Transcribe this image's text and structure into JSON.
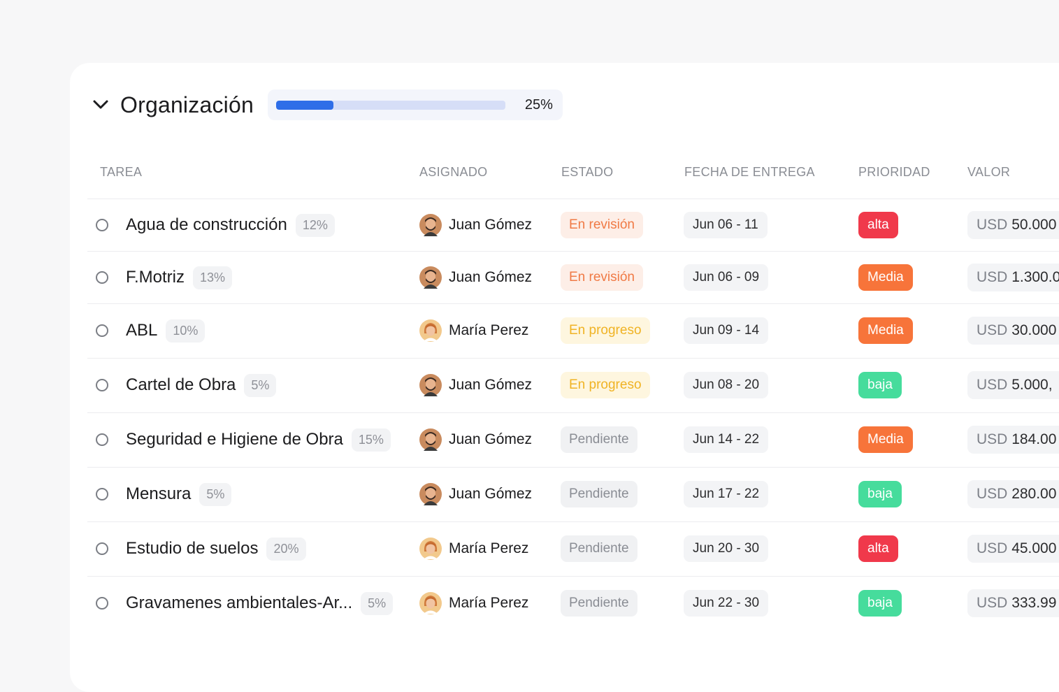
{
  "group": {
    "title": "Organización",
    "progress": 0.25,
    "progress_label": "25%"
  },
  "columns": [
    "TAREA",
    "ASIGNADO",
    "ESTADO",
    "FECHA DE ENTREGA",
    "PRIORIDAD",
    "VALOR"
  ],
  "colors": {
    "en_revision_bg": "#fdeee7",
    "en_revision_fg": "#f07a45",
    "en_progreso_bg": "#fef6df",
    "en_progreso_fg": "#f0b324",
    "pendiente_bg": "#f0f1f3",
    "pendiente_fg": "#8a8d94",
    "alta": "#f0394b",
    "media": "#f7743a",
    "baja": "#46dc9c",
    "progress_fill": "#2f6ee8",
    "progress_track": "#d6def7"
  },
  "rows": [
    {
      "task": "Agua de construcción",
      "pct": "12%",
      "assignee": "Juan Gómez",
      "avatar": "man",
      "status": "En revisión",
      "status_kind": "revision",
      "date": "Jun 06 - 11",
      "priority": "alta",
      "prio_kind": "alta",
      "currency": "USD",
      "amount": "50.000"
    },
    {
      "task": "F.Motriz",
      "pct": "13%",
      "assignee": "Juan Gómez",
      "avatar": "man",
      "status": "En revisión",
      "status_kind": "revision",
      "date": "Jun 06 - 09",
      "priority": "Media",
      "prio_kind": "media",
      "currency": "USD",
      "amount": "1.300.0"
    },
    {
      "task": "ABL",
      "pct": "10%",
      "assignee": "María Perez",
      "avatar": "woman",
      "status": "En progreso",
      "status_kind": "progreso",
      "date": "Jun 09 - 14",
      "priority": "Media",
      "prio_kind": "media",
      "currency": "USD",
      "amount": "30.000"
    },
    {
      "task": "Cartel de Obra",
      "pct": "5%",
      "assignee": "Juan Gómez",
      "avatar": "man",
      "status": "En progreso",
      "status_kind": "progreso",
      "date": "Jun 08 - 20",
      "priority": "baja",
      "prio_kind": "baja",
      "currency": "USD",
      "amount": "5.000,"
    },
    {
      "task": "Seguridad e Higiene de Obra",
      "pct": "15%",
      "assignee": "Juan Gómez",
      "avatar": "man",
      "status": "Pendiente",
      "status_kind": "pendiente",
      "date": "Jun 14 - 22",
      "priority": "Media",
      "prio_kind": "media",
      "currency": "USD",
      "amount": "184.00"
    },
    {
      "task": "Mensura",
      "pct": "5%",
      "assignee": "Juan Gómez",
      "avatar": "man",
      "status": "Pendiente",
      "status_kind": "pendiente",
      "date": "Jun 17 - 22",
      "priority": "baja",
      "prio_kind": "baja",
      "currency": "USD",
      "amount": "280.00"
    },
    {
      "task": "Estudio de suelos",
      "pct": "20%",
      "assignee": "María Perez",
      "avatar": "woman",
      "status": "Pendiente",
      "status_kind": "pendiente",
      "date": "Jun 20 - 30",
      "priority": "alta",
      "prio_kind": "alta",
      "currency": "USD",
      "amount": "45.000"
    },
    {
      "task": "Gravamenes ambientales-Ar...",
      "pct": "5%",
      "assignee": "María Perez",
      "avatar": "woman",
      "status": "Pendiente",
      "status_kind": "pendiente",
      "date": "Jun 22 - 30",
      "priority": "baja",
      "prio_kind": "baja",
      "currency": "USD",
      "amount": "333.99"
    }
  ]
}
